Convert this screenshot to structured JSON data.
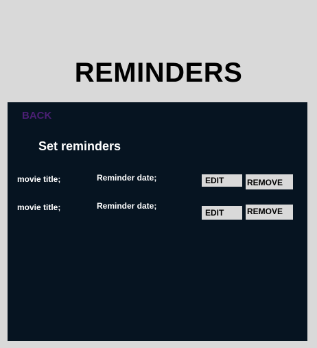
{
  "header": {
    "title": "REMINDERS"
  },
  "panel": {
    "back_label": "BACK",
    "section_title": "Set reminders",
    "reminders": [
      {
        "movie_title_label": "movie title;",
        "reminder_date_label": "Reminder date;",
        "edit_label": "EDIT",
        "remove_label": "REMOVE"
      },
      {
        "movie_title_label": "movie title;",
        "reminder_date_label": "Reminder date;",
        "edit_label": "EDIT",
        "remove_label": "REMOVE"
      }
    ]
  },
  "colors": {
    "page_background": "#d9d9d9",
    "panel_background": "#061421",
    "back_link": "#4b1f74",
    "button_background": "#d9d9d9",
    "text_light": "#ffffff",
    "text_dark": "#000000"
  }
}
